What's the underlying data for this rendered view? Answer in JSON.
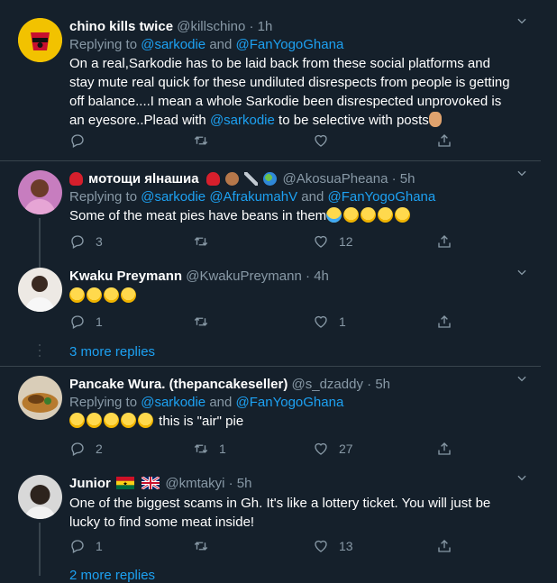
{
  "tweets": [
    {
      "name": "chino kills twice",
      "handle": "@killschino",
      "time": "1h",
      "reply_prefix": "Replying to",
      "reply_to_1": "@sarkodie",
      "reply_and": "and",
      "reply_to_2": "@FanYogoGhana",
      "text_1": "On a real,Sarkodie has to be laid back from these social platforms and",
      "text_2": "stay mute real quick for these undiluted disrespects from people is getting",
      "text_3": "off balance....I mean a whole Sarkodie been disrespected unprovoked is",
      "text_4a": "an eyesore..Plead with",
      "text_4_mention": "@sarkodie",
      "text_4b": "to be selective with posts",
      "reply_count": "",
      "retweet_count": "",
      "like_count": ""
    },
    {
      "name": "мотощи яlнашиа",
      "handle": "@AkosuaPheana",
      "time": "5h",
      "reply_prefix": "Replying to",
      "reply_to_1": "@sarkodie",
      "reply_to_2": "@AfrakumahV",
      "reply_and": "and",
      "reply_to_3": "@FanYogoGhana",
      "text": "Some of the meat pies have beans in them",
      "reply_count": "3",
      "retweet_count": "",
      "like_count": "12"
    },
    {
      "name": "Kwaku Preymann",
      "handle": "@KwakuPreymann",
      "time": "4h",
      "reply_count": "1",
      "retweet_count": "",
      "like_count": "1"
    },
    {
      "name": "Pancake Wura. (thepancakeseller)",
      "handle": "@s_dzaddy",
      "time": "5h",
      "reply_prefix": "Replying to",
      "reply_to_1": "@sarkodie",
      "reply_and": "and",
      "reply_to_2": "@FanYogoGhana",
      "text": "this is \"air\" pie",
      "reply_count": "2",
      "retweet_count": "1",
      "like_count": "27"
    },
    {
      "name": "Junior",
      "handle": "@kmtakyi",
      "time": "5h",
      "text_1": "One of the biggest scams in Gh. It's like a lottery ticket. You will just be",
      "text_2": "lucky to find some meat inside!",
      "reply_count": "1",
      "retweet_count": "",
      "like_count": "13"
    }
  ],
  "more_replies_1": "3 more replies",
  "more_replies_2": "2 more replies",
  "separator_dot": "·",
  "colors": {
    "background": "#15202b",
    "accent": "#1da1f2",
    "muted": "#8899a6",
    "divider": "#38444d"
  }
}
